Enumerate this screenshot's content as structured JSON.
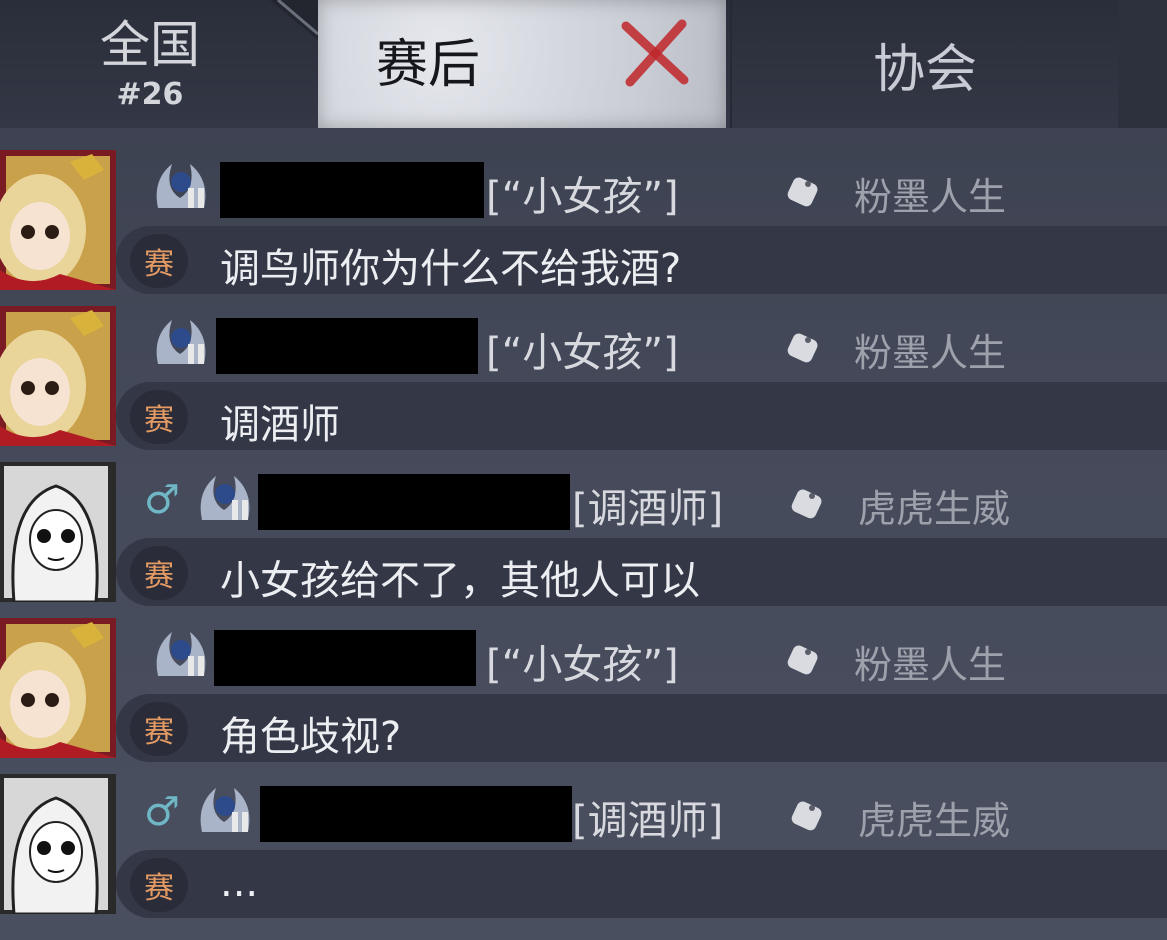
{
  "tabs": {
    "national_label": "全国",
    "national_rank": "#26",
    "postgame_label": "赛后",
    "association_label": "协会"
  },
  "messages": [
    {
      "role": "[“小女孩”]",
      "nickname": "粉墨人生",
      "channel": "赛",
      "text": "调鸟师你为什么不给我酒?",
      "gender": ""
    },
    {
      "role": "[“小女孩”]",
      "nickname": "粉墨人生",
      "channel": "赛",
      "text": "调酒师",
      "gender": ""
    },
    {
      "role": "[调酒师]",
      "nickname": "虎虎生威",
      "channel": "赛",
      "text": "小女孩给不了，其他人可以",
      "gender": "♂"
    },
    {
      "role": "[“小女孩”]",
      "nickname": "粉墨人生",
      "channel": "赛",
      "text": "角色歧视?",
      "gender": ""
    },
    {
      "role": "[调酒师]",
      "nickname": "虎虎生威",
      "channel": "赛",
      "text": "...",
      "gender": "♂"
    }
  ],
  "icons": {
    "close": "close-x-icon",
    "gender": "male-icon",
    "badge": "rank-badge-icon",
    "tag": "tag-icon"
  },
  "colors": {
    "accent_channel": "#e59b64",
    "gender_male": "#6fb7c5",
    "close_x": "#c0262a"
  }
}
